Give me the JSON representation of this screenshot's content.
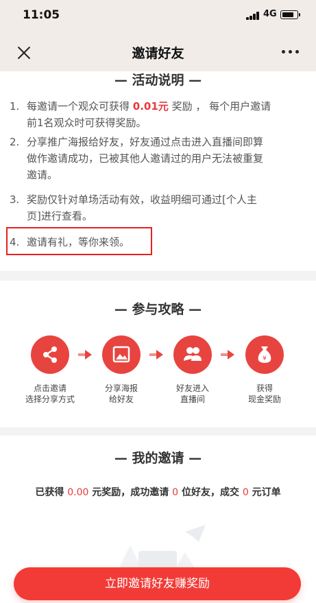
{
  "status": {
    "time": "11:05",
    "network": "4G"
  },
  "nav": {
    "title": "邀请好友"
  },
  "activity": {
    "title": "— 活动说明 —",
    "rules": [
      {
        "num": "1.",
        "line1_pre": "每邀请一个观众可获得 ",
        "line1_amount": "0.01元",
        "line1_post": " 奖励 ， 每个用户邀请",
        "line2": "前1名观众时可获得奖励。"
      },
      {
        "num": "2.",
        "line1": "分享推广海报给好友，好友通过点击进入直播间即算",
        "line2": "做作邀请成功，已被其他人邀请过的用户无法被重复",
        "line3": "邀请。"
      },
      {
        "num": "3.",
        "line1": "奖励仅针对单场活动有效，收益明细可通过[个人主",
        "line2": "页]进行查看。"
      },
      {
        "num": "4.",
        "line1": "邀请有礼，等你来领。"
      }
    ]
  },
  "guide": {
    "title": "— 参与攻略 —",
    "steps": [
      {
        "icon": "share-icon",
        "line1": "点击邀请",
        "line2": "选择分享方式"
      },
      {
        "icon": "image-icon",
        "line1": "分享海报",
        "line2": "给好友"
      },
      {
        "icon": "users-icon",
        "line1": "好友进入",
        "line2": "直播间"
      },
      {
        "icon": "money-bag-icon",
        "line1": "获得",
        "line2": "现金奖励"
      }
    ]
  },
  "my_invite": {
    "title": "— 我的邀请 —",
    "earned_label": "已获得 ",
    "earned_value": "0.00",
    "earned_unit": " 元奖励，成功邀请 ",
    "invited_value": "0",
    "invited_unit": " 位好友，成交 ",
    "orders_value": "0",
    "orders_unit": " 元订单"
  },
  "cta": {
    "label": "立即邀请好友赚奖励"
  },
  "colors": {
    "accent": "#e8443f",
    "cta": "#f23b37",
    "highlight": "#e52020"
  }
}
